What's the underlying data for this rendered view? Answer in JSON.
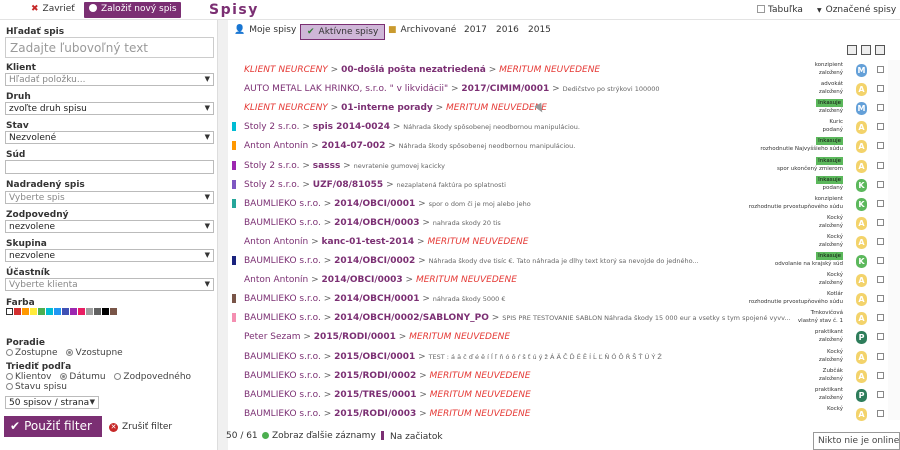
{
  "topbar": {
    "close_label": "Zavrieť",
    "new_label": "Založiť nový spis",
    "title": "Spisy",
    "table_label": "Tabuľka",
    "selected_label": "Označené spisy"
  },
  "sidebar": {
    "search_label": "Hľadať spis",
    "search_placeholder": "Zadajte ľubovoľný text",
    "client_label": "Klient",
    "client_value": "Hľadať položku...",
    "type_label": "Druh",
    "type_value": "zvoľte druh spisu",
    "state_label": "Stav",
    "state_value": "Nezvolené",
    "court_label": "Súd",
    "court_value": "",
    "parent_label": "Nadradený spis",
    "parent_value": "Vyberte spis",
    "resp_label": "Zodpovedný",
    "resp_value": "nezvolene",
    "group_label": "Skupina",
    "group_value": "nezvolene",
    "participant_label": "Účastník",
    "participant_value": "Vyberte klienta",
    "color_label": "Farba",
    "colors": [
      "#ffffff",
      "#d32f2f",
      "#ff9800",
      "#ffeb3b",
      "#4caf50",
      "#00bcd4",
      "#2196f3",
      "#3f51b5",
      "#9c27b0",
      "#e91e63",
      "#9e9e9e",
      "#616161",
      "#000000",
      "#795548"
    ],
    "order_label": "Poradie",
    "order_options": [
      "Zostupne",
      "Vzostupne"
    ],
    "sort_label": "Triediť podľa",
    "sort_options": [
      "Klientov",
      "Dátumu",
      "Zodpovedného",
      "Stavu spisu"
    ],
    "per_page": "50 spisov / strana",
    "apply_label": "Použiť filter",
    "cancel_label": "Zrušiť filter"
  },
  "tabs": [
    {
      "label": "Moje spisy",
      "icon": "user-icon"
    },
    {
      "label": "Aktívne spisy",
      "icon": "check-icon",
      "active": true
    },
    {
      "label": "Archivované",
      "icon": "box-icon"
    },
    {
      "label": "2017"
    },
    {
      "label": "2016"
    },
    {
      "label": "2015"
    }
  ],
  "rows": [
    {
      "bar": "",
      "parts": [
        [
          "red",
          "KLIENT NEURČENÝ"
        ],
        [
          "gt",
          " > "
        ],
        [
          "b",
          "00-došlá pošta nezatriedená"
        ],
        [
          "gt",
          " > "
        ],
        [
          "red",
          "MERITUM NEUVEDENÉ"
        ]
      ],
      "meta": [
        "konzipient",
        "založený"
      ],
      "circle": "M",
      "ccolor": "#64a0d8"
    },
    {
      "bar": "",
      "parts": [
        [
          "pre",
          "AUTO METAL LAK HRINKO, s.r.o. \" v likvidácii\""
        ],
        [
          "gt",
          " > "
        ],
        [
          "b",
          "2017/CIMIM/0001"
        ],
        [
          "gt",
          " > "
        ],
        [
          "g",
          "Dedičstvo po strýkovi 100000"
        ]
      ],
      "meta": [
        "advokát",
        "založený"
      ],
      "circle": "A",
      "ccolor": "#f3d36b"
    },
    {
      "bar": "",
      "parts": [
        [
          "red",
          "KLIENT NEURČENÝ"
        ],
        [
          "gt",
          " > "
        ],
        [
          "b",
          "01-interne porady"
        ],
        [
          "gt",
          " > "
        ],
        [
          "red",
          "MERITUM NEUVEDENÉ"
        ]
      ],
      "meta": [
        "Inkasuje",
        "založený"
      ],
      "badge": 0,
      "circle": "M",
      "ccolor": "#64a0d8"
    },
    {
      "bar": "#00bcd4",
      "parts": [
        [
          "pre",
          "Stoly 2 s.r.o."
        ],
        [
          "gt",
          " > "
        ],
        [
          "b",
          "spis 2014-0024"
        ],
        [
          "gt",
          " > "
        ],
        [
          "g",
          "Náhrada škody spôsobenej neodbornou manipuláciou."
        ]
      ],
      "meta": [
        "Kuric",
        "podaný"
      ],
      "circle": "A",
      "ccolor": "#f3d36b"
    },
    {
      "bar": "#ff9800",
      "parts": [
        [
          "pre",
          "Anton Antonín"
        ],
        [
          "gt",
          " > "
        ],
        [
          "b",
          "2014-07-002"
        ],
        [
          "gt",
          " > "
        ],
        [
          "g",
          "Náhrada škody spôsobenej neodbornou manipuláciou."
        ]
      ],
      "meta": [
        "Inkasuje",
        "rozhodnutie Najvyššieho súdu"
      ],
      "badge": 0,
      "circle": "A",
      "ccolor": "#f3d36b"
    },
    {
      "bar": "#9c27b0",
      "parts": [
        [
          "pre",
          "Stoly 2 s.r.o."
        ],
        [
          "gt",
          " > "
        ],
        [
          "b",
          "sasss"
        ],
        [
          "gt",
          " > "
        ],
        [
          "g",
          "nevratenie gumovej kacicky"
        ]
      ],
      "meta": [
        "Inkasuje",
        "spor ukončený zmierom"
      ],
      "badge": 0,
      "circle": "A",
      "ccolor": "#f3d36b"
    },
    {
      "bar": "#7e57c2",
      "parts": [
        [
          "pre",
          "Stoly 2 s.r.o."
        ],
        [
          "gt",
          " > "
        ],
        [
          "b",
          "UZF/08/81055"
        ],
        [
          "gt",
          " > "
        ],
        [
          "g",
          "nezaplatená faktúra po splatnosti"
        ]
      ],
      "meta": [
        "Inkasuje",
        "podaný"
      ],
      "badge": 0,
      "circle": "K",
      "ccolor": "#5cb85c"
    },
    {
      "bar": "#26a69a",
      "parts": [
        [
          "pre",
          "BAUMLIEKO s.r.o."
        ],
        [
          "gt",
          " > "
        ],
        [
          "b",
          "2014/OBCI/0001"
        ],
        [
          "gt",
          " > "
        ],
        [
          "g",
          "spor o dom či je moj alebo jeho"
        ]
      ],
      "meta": [
        "konzipient",
        "rozhodnutie prvostupňového súdu"
      ],
      "circle": "K",
      "ccolor": "#5cb85c"
    },
    {
      "bar": "",
      "parts": [
        [
          "pre",
          "BAUMLIEKO s.r.o."
        ],
        [
          "gt",
          " > "
        ],
        [
          "b",
          "2014/OBCH/0003"
        ],
        [
          "gt",
          " > "
        ],
        [
          "g",
          "nahrada skody 20 tis"
        ]
      ],
      "meta": [
        "Kocký",
        "založený"
      ],
      "circle": "A",
      "ccolor": "#f3d36b"
    },
    {
      "bar": "",
      "parts": [
        [
          "pre",
          "Anton Antonín"
        ],
        [
          "gt",
          " > "
        ],
        [
          "b",
          "kanc-01-test-2014"
        ],
        [
          "gt",
          " > "
        ],
        [
          "red",
          "MERITUM NEUVEDENÉ"
        ]
      ],
      "meta": [
        "Kocký",
        "založený"
      ],
      "circle": "A",
      "ccolor": "#f3d36b"
    },
    {
      "bar": "#1a237e",
      "parts": [
        [
          "pre",
          "BAUMLIEKO s.r.o."
        ],
        [
          "gt",
          " > "
        ],
        [
          "b",
          "2014/OBCI/0002"
        ],
        [
          "gt",
          " > "
        ],
        [
          "g",
          "Náhrada škody dve tisíc €. Tato náhrada je dlhy text ktorý sa nevojde do jedného..."
        ]
      ],
      "meta": [
        "Inkasuje",
        "odvolanie na krajský súd"
      ],
      "badge": 0,
      "circle": "K",
      "ccolor": "#5cb85c"
    },
    {
      "bar": "",
      "parts": [
        [
          "pre",
          "Anton Antonín"
        ],
        [
          "gt",
          " > "
        ],
        [
          "b",
          "2014/OBCI/0003"
        ],
        [
          "gt",
          " > "
        ],
        [
          "red",
          "MERITUM NEUVEDENÉ"
        ]
      ],
      "meta": [
        "Kocký",
        "založený"
      ],
      "circle": "A",
      "ccolor": "#f3d36b"
    },
    {
      "bar": "#795548",
      "parts": [
        [
          "pre",
          "BAUMLIEKO s.r.o."
        ],
        [
          "gt",
          " > "
        ],
        [
          "b",
          "2014/OBCH/0001"
        ],
        [
          "gt",
          " > "
        ],
        [
          "g",
          "náhrada škody 5000 €"
        ]
      ],
      "meta": [
        "Kotlár",
        "rozhodnutie prvostupňového súdu"
      ],
      "circle": "A",
      "ccolor": "#f3d36b"
    },
    {
      "bar": "#f48fb1",
      "parts": [
        [
          "pre",
          "BAUMLIEKO s.r.o."
        ],
        [
          "gt",
          " > "
        ],
        [
          "b",
          "2014/OBCH/0002/SABLONY_PO"
        ],
        [
          "gt",
          " > "
        ],
        [
          "g",
          "SPIS PRE TESTOVANIE SABLON Náhrada škody 15 000 eur a vsetky s tym spojené vyvv..."
        ]
      ],
      "meta": [
        "Trnkovičová",
        "vlastný stav č. 1"
      ],
      "circle": "A",
      "ccolor": "#f3d36b"
    },
    {
      "bar": "",
      "parts": [
        [
          "pre",
          "Peter Sezam"
        ],
        [
          "gt",
          " > "
        ],
        [
          "b",
          "2015/RODI/0001"
        ],
        [
          "gt",
          " > "
        ],
        [
          "red",
          "MERITUM NEUVEDENÉ"
        ]
      ],
      "meta": [
        "praktikant",
        "založený"
      ],
      "circle": "P",
      "ccolor": "#2e7d5b"
    },
    {
      "bar": "",
      "parts": [
        [
          "pre",
          "BAUMLIEKO s.r.o."
        ],
        [
          "gt",
          " > "
        ],
        [
          "b",
          "2015/OBCI/0001"
        ],
        [
          "gt",
          " > "
        ],
        [
          "g",
          "TEST : á ä č ď é ě í ĺ ľ ň ó ô ŕ š ť ú ý ž Á Ä Č Ď É Ě Í Ĺ Ľ Ň Ó Ô Ŕ Š Ť Ú Ý Ž"
        ]
      ],
      "meta": [
        "Kocký",
        "založený"
      ],
      "circle": "A",
      "ccolor": "#f3d36b"
    },
    {
      "bar": "",
      "parts": [
        [
          "pre",
          "BAUMLIEKO s.r.o."
        ],
        [
          "gt",
          " > "
        ],
        [
          "b",
          "2015/RODI/0002"
        ],
        [
          "gt",
          " > "
        ],
        [
          "red",
          "MERITUM NEUVEDENÉ"
        ]
      ],
      "meta": [
        "Zubčák",
        "založený"
      ],
      "circle": "A",
      "ccolor": "#f3d36b"
    },
    {
      "bar": "",
      "parts": [
        [
          "pre",
          "BAUMLIEKO s.r.o."
        ],
        [
          "gt",
          " > "
        ],
        [
          "b",
          "2015/TRES/0001"
        ],
        [
          "gt",
          " > "
        ],
        [
          "red",
          "MERITUM NEUVEDENÉ"
        ]
      ],
      "meta": [
        "praktikant",
        "založený"
      ],
      "circle": "P",
      "ccolor": "#2e7d5b"
    },
    {
      "bar": "",
      "parts": [
        [
          "pre",
          "BAUMLIEKO s.r.o."
        ],
        [
          "gt",
          " > "
        ],
        [
          "b",
          "2015/RODI/0003"
        ],
        [
          "gt",
          " > "
        ],
        [
          "red",
          "MERITUM NEUVEDENÉ"
        ]
      ],
      "meta": [
        "Kocký",
        ""
      ],
      "circle": "A",
      "ccolor": "#f3d36b"
    }
  ],
  "footer": {
    "count": "50 / 61",
    "more_label": "Zobraz ďalšie záznamy",
    "top_label": "Na začiatok"
  },
  "chat": "Nikto nie je online."
}
